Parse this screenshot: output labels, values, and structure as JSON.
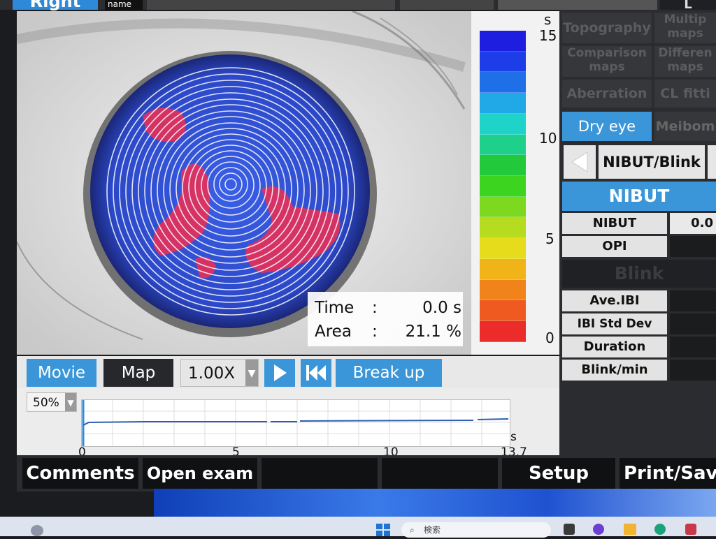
{
  "header": {
    "eye_side": "Right",
    "name_label": "name"
  },
  "scale": {
    "unit": "s",
    "ticks": [
      "15",
      "10",
      "5",
      "0"
    ],
    "colors": [
      "#1d1ee0",
      "#1d3de8",
      "#1f6fe8",
      "#21a8e6",
      "#1ed3c7",
      "#1fd08a",
      "#22c93b",
      "#3dd41f",
      "#7cd91f",
      "#b5dc1e",
      "#e6dc1c",
      "#f0b419",
      "#f0841a",
      "#ee5a20",
      "#ec2b2b"
    ]
  },
  "readout": {
    "time_label": "Time",
    "time_value": "0.0 s",
    "area_label": "Area",
    "area_value": "21.1 %",
    "separator": ":"
  },
  "controls": {
    "movie": "Movie",
    "map": "Map",
    "speed": "1.00X",
    "play_icon": "play-icon",
    "rewind_icon": "rewind-icon",
    "breakup": "Break up",
    "zoom": "50%"
  },
  "timeline": {
    "x_ticks": [
      "0",
      "5",
      "10",
      "13.7"
    ],
    "unit": "s"
  },
  "function_bar": {
    "comments": "Comments",
    "open_exam": "Open exam",
    "setup": "Setup",
    "print_save": "Print/Sav"
  },
  "right_panel": {
    "menu": [
      "Topography",
      "Multip maps",
      "Comparison maps",
      "Differen maps",
      "Aberration",
      "CL fitti"
    ],
    "dry_eye": "Dry eye",
    "meibom": "Meibom",
    "mode_selector": "NIBUT/Blink",
    "nibut_header": "NIBUT",
    "nibut_rows": [
      {
        "label": "NIBUT",
        "value": "0.0"
      },
      {
        "label": "OPI",
        "value": ""
      }
    ],
    "blink_header": "Blink",
    "blink_rows": [
      {
        "label": "Ave.IBI",
        "value": ""
      },
      {
        "label": "IBI Std Dev",
        "value": ""
      },
      {
        "label": "Duration",
        "value": ""
      },
      {
        "label": "Blink/min",
        "value": ""
      }
    ],
    "top_right": "L"
  },
  "taskbar": {
    "search_placeholder": "検索"
  }
}
